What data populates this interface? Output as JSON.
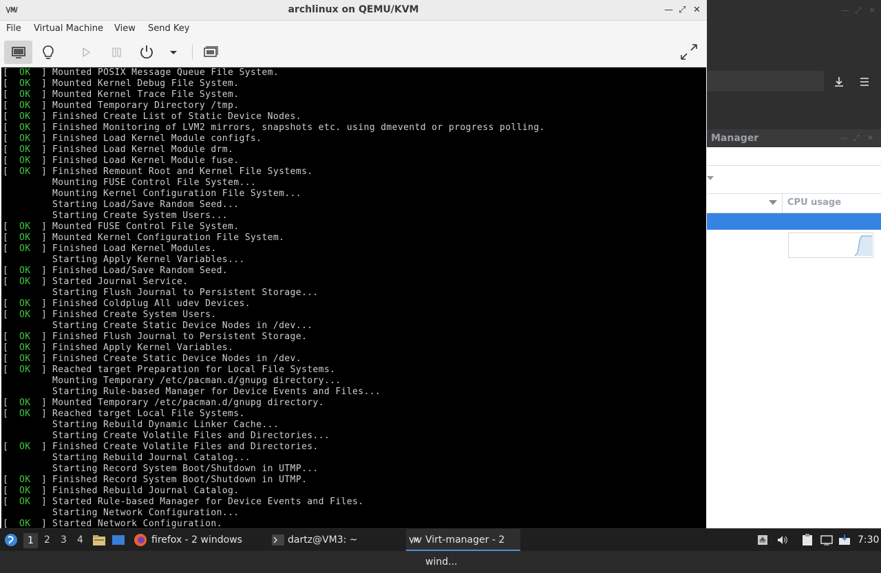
{
  "window": {
    "title": "archlinux on QEMU/KVM",
    "menu": [
      "File",
      "Virtual Machine",
      "View",
      "Send Key"
    ]
  },
  "toolbar": {
    "buttons": [
      "display-icon",
      "lightbulb-icon",
      "play-icon",
      "pause-icon",
      "power-icon",
      "chevron-down-icon",
      "screens-icon",
      "fullscreen-icon"
    ]
  },
  "console": {
    "lines": [
      {
        "ok": true,
        "text": "Mounted POSIX Message Queue File System."
      },
      {
        "ok": true,
        "text": "Mounted Kernel Debug File System."
      },
      {
        "ok": true,
        "text": "Mounted Kernel Trace File System."
      },
      {
        "ok": true,
        "text": "Mounted Temporary Directory /tmp."
      },
      {
        "ok": true,
        "text": "Finished Create List of Static Device Nodes."
      },
      {
        "ok": true,
        "text": "Finished Monitoring of LVM2 mirrors, snapshots etc. using dmeventd or progress polling."
      },
      {
        "ok": true,
        "text": "Finished Load Kernel Module configfs."
      },
      {
        "ok": true,
        "text": "Finished Load Kernel Module drm."
      },
      {
        "ok": true,
        "text": "Finished Load Kernel Module fuse."
      },
      {
        "ok": true,
        "text": "Finished Remount Root and Kernel File Systems."
      },
      {
        "ok": false,
        "text": "Mounting FUSE Control File System..."
      },
      {
        "ok": false,
        "text": "Mounting Kernel Configuration File System..."
      },
      {
        "ok": false,
        "text": "Starting Load/Save Random Seed..."
      },
      {
        "ok": false,
        "text": "Starting Create System Users..."
      },
      {
        "ok": true,
        "text": "Mounted FUSE Control File System."
      },
      {
        "ok": true,
        "text": "Mounted Kernel Configuration File System."
      },
      {
        "ok": true,
        "text": "Finished Load Kernel Modules."
      },
      {
        "ok": false,
        "text": "Starting Apply Kernel Variables..."
      },
      {
        "ok": true,
        "text": "Finished Load/Save Random Seed."
      },
      {
        "ok": true,
        "text": "Started Journal Service."
      },
      {
        "ok": false,
        "text": "Starting Flush Journal to Persistent Storage..."
      },
      {
        "ok": true,
        "text": "Finished Coldplug All udev Devices."
      },
      {
        "ok": true,
        "text": "Finished Create System Users."
      },
      {
        "ok": false,
        "text": "Starting Create Static Device Nodes in /dev..."
      },
      {
        "ok": true,
        "text": "Finished Flush Journal to Persistent Storage."
      },
      {
        "ok": true,
        "text": "Finished Apply Kernel Variables."
      },
      {
        "ok": true,
        "text": "Finished Create Static Device Nodes in /dev."
      },
      {
        "ok": true,
        "text": "Reached target Preparation for Local File Systems."
      },
      {
        "ok": false,
        "text": "Mounting Temporary /etc/pacman.d/gnupg directory..."
      },
      {
        "ok": false,
        "text": "Starting Rule-based Manager for Device Events and Files..."
      },
      {
        "ok": true,
        "text": "Mounted Temporary /etc/pacman.d/gnupg directory."
      },
      {
        "ok": true,
        "text": "Reached target Local File Systems."
      },
      {
        "ok": false,
        "text": "Starting Rebuild Dynamic Linker Cache..."
      },
      {
        "ok": false,
        "text": "Starting Create Volatile Files and Directories..."
      },
      {
        "ok": true,
        "text": "Finished Create Volatile Files and Directories."
      },
      {
        "ok": false,
        "text": "Starting Rebuild Journal Catalog..."
      },
      {
        "ok": false,
        "text": "Starting Record System Boot/Shutdown in UTMP..."
      },
      {
        "ok": true,
        "text": "Finished Record System Boot/Shutdown in UTMP."
      },
      {
        "ok": true,
        "text": "Finished Rebuild Journal Catalog."
      },
      {
        "ok": true,
        "text": "Started Rule-based Manager for Device Events and Files."
      },
      {
        "ok": false,
        "text": "Starting Network Configuration..."
      },
      {
        "ok": true,
        "text": "Started Network Configuration."
      }
    ],
    "status_open": "[",
    "status_ok": "OK",
    "status_close": "]"
  },
  "background": {
    "vmm_title": "Manager",
    "vmm_column": "CPU usage"
  },
  "taskbar": {
    "workspaces": [
      "1",
      "2",
      "3",
      "4"
    ],
    "tasks": [
      {
        "label": "firefox - 2 windows",
        "icon": "firefox-icon"
      },
      {
        "label": "dartz@VM3: ~",
        "icon": "terminal-icon"
      },
      {
        "label": "Virt-manager - 2 wind...",
        "icon": "virt-manager-icon"
      }
    ],
    "clock": "7:30"
  },
  "colors": {
    "ok_green": "#3ccb3c",
    "console_bg": "#000000",
    "selection_blue": "#3584e4"
  }
}
